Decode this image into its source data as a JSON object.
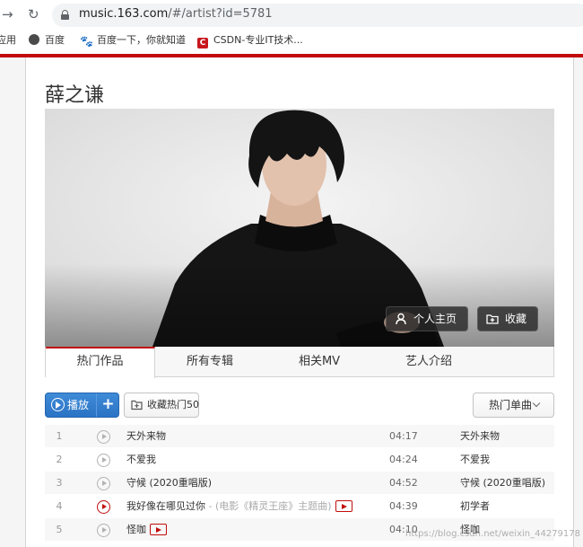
{
  "browser": {
    "url_host": "music.163.com",
    "url_path": "/#/artist?id=5781",
    "bookmarks": [
      "应用",
      "百度",
      "百度一下，你就知道",
      "CSDN-专业IT技术..."
    ]
  },
  "artist": {
    "name": "薛之谦",
    "home_button": "个人主页",
    "collect_button": "收藏"
  },
  "tabs": [
    "热门作品",
    "所有专辑",
    "相关MV",
    "艺人介绍"
  ],
  "toolbar": {
    "play_label": "播放",
    "add_label": "+",
    "collect_hot_label": "收藏热门50",
    "sort_label": "热门单曲"
  },
  "songs": [
    {
      "num": "1",
      "title": "天外来物",
      "subtitle": "",
      "has_mv": false,
      "duration": "04:17",
      "album": "天外来物",
      "active": false
    },
    {
      "num": "2",
      "title": "不爱我",
      "subtitle": "",
      "has_mv": false,
      "duration": "04:24",
      "album": "不爱我",
      "active": false
    },
    {
      "num": "3",
      "title": "守候 (2020重唱版)",
      "subtitle": "",
      "has_mv": false,
      "duration": "04:52",
      "album": "守候 (2020重唱版)",
      "active": false
    },
    {
      "num": "4",
      "title": "我好像在哪见过你",
      "subtitle": " - (电影《精灵王座》主题曲)",
      "has_mv": true,
      "duration": "04:39",
      "album": "初学者",
      "active": true
    },
    {
      "num": "5",
      "title": "怪咖",
      "subtitle": "",
      "has_mv": true,
      "duration": "04:10",
      "album": "怪咖",
      "active": false
    }
  ],
  "watermark": "https://blog.csdn.net/weixin_44279178",
  "colors": {
    "accent_red": "#c20c0c",
    "play_blue": "#2b73c4"
  }
}
